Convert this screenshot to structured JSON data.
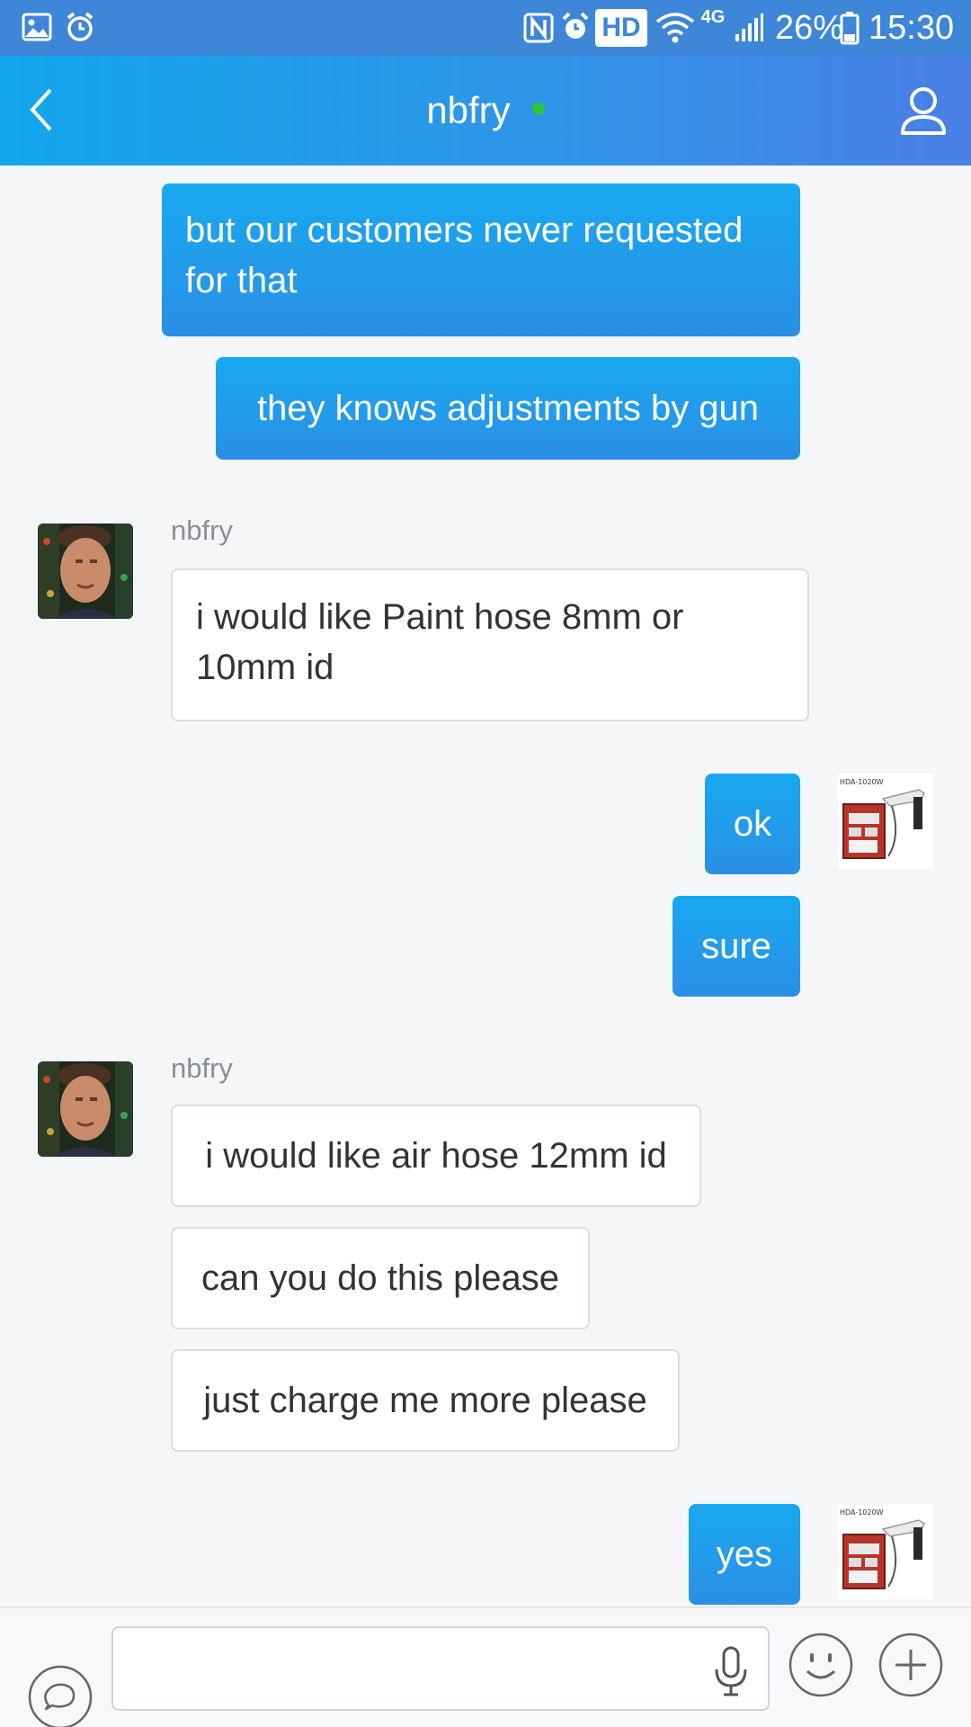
{
  "status_bar": {
    "icons": [
      "gallery-icon",
      "alarm-clock-icon",
      "nfc-icon",
      "alarm-icon",
      "hd-badge",
      "wifi-icon",
      "4g-icon",
      "signal-icon",
      "battery-icon"
    ],
    "hd_label": "HD",
    "network_label": "4G",
    "battery": "26%",
    "time": "15:30"
  },
  "header": {
    "title": "nbfry",
    "online": true,
    "colors": {
      "start": "#12a6ec",
      "end": "#4a7fe6",
      "online_dot": "#29c73c"
    }
  },
  "messages": [
    {
      "dir": "out",
      "text": "but our customers never requested for that"
    },
    {
      "dir": "out",
      "text": "they knows adjustments by gun"
    },
    {
      "dir": "in",
      "sender": "nbfry",
      "text": "i would like Paint hose 8mm or 10mm id"
    },
    {
      "dir": "out",
      "text": "ok"
    },
    {
      "dir": "out",
      "text": "sure"
    },
    {
      "dir": "in",
      "sender": "nbfry",
      "text": "i would like air hose 12mm id"
    },
    {
      "dir": "in",
      "text": "can you do this please"
    },
    {
      "dir": "in",
      "text": "just charge me more please"
    },
    {
      "dir": "out",
      "text": "yes"
    }
  ],
  "product_thumbnail_label": "HDA-1020W",
  "composer": {
    "placeholder": "",
    "icons": [
      "chat-bubble-icon",
      "microphone-icon",
      "emoji-icon",
      "plus-icon"
    ]
  },
  "colors": {
    "outgoing_bubble": "#18a9f0",
    "incoming_bubble": "#ffffff",
    "background": "#f5f6f8"
  }
}
